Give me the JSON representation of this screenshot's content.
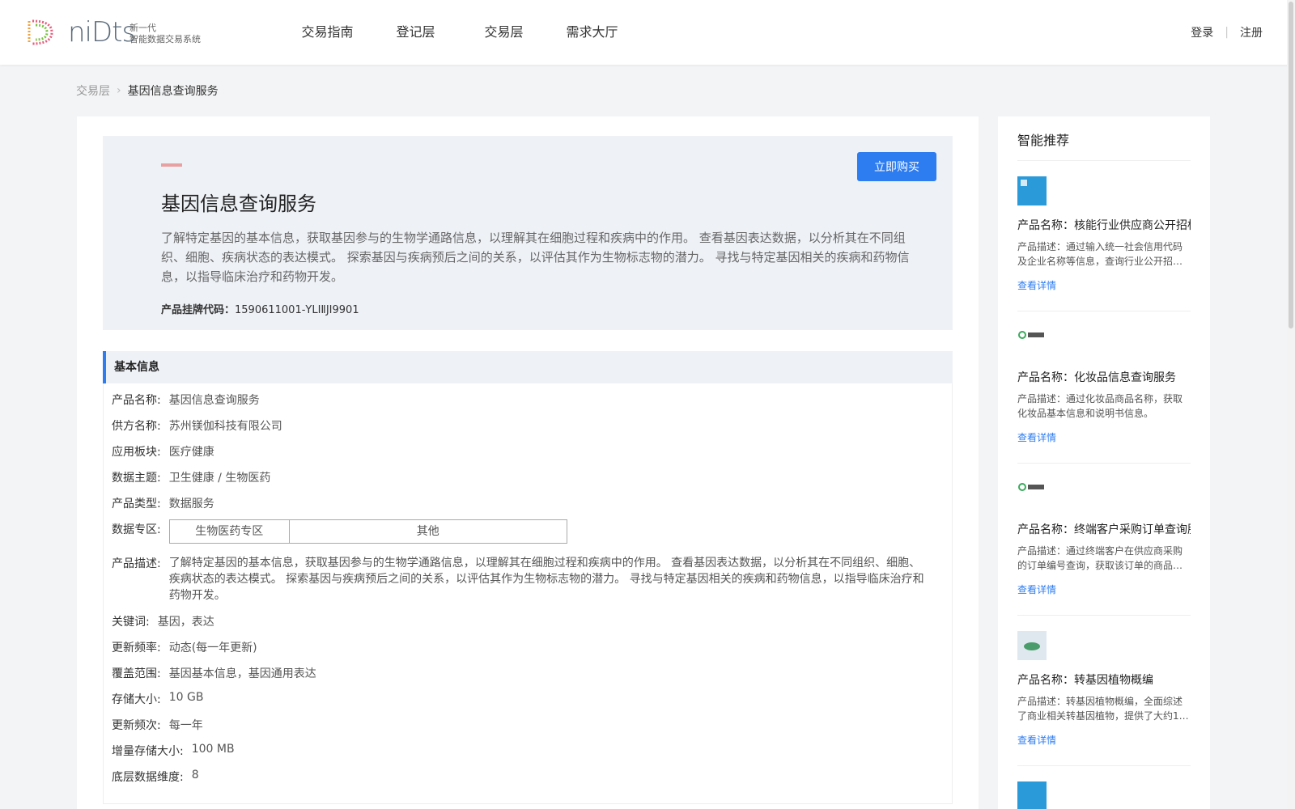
{
  "header": {
    "logo_word": "niDts",
    "logo_sub_line1": "新一代",
    "logo_sub_line2": "智能数据交易系统",
    "nav": [
      "交易指南",
      "登记层",
      "交易层",
      "需求大厅"
    ],
    "login": "登录",
    "register": "注册"
  },
  "breadcrumb": {
    "parent": "交易层",
    "current": "基因信息查询服务"
  },
  "hero": {
    "title": "基因信息查询服务",
    "description": "了解特定基因的基本信息，获取基因参与的生物学通路信息，以理解其在细胞过程和疾病中的作用。 查看基因表达数据，以分析其在不同组织、细胞、疾病状态的表达模式。 探索基因与疾病预后之间的关系，以评估其作为生物标志物的潜力。 寻找与特定基因相关的疾病和药物信息，以指导临床治疗和药物开发。",
    "code_label": "产品挂牌代码：",
    "code_value": "1590611001-YLIⅡJI9901",
    "buy_label": "立即购买"
  },
  "basic": {
    "section_title": "基本信息",
    "product_name": {
      "k": "产品名称:",
      "v": "基因信息查询服务"
    },
    "supplier": {
      "k": "供方名称:",
      "v": "苏州镁伽科技有限公司"
    },
    "sector": {
      "k": "应用板块:",
      "v": "医疗健康"
    },
    "topic": {
      "k": "数据主题:",
      "v": "卫生健康 / 生物医药"
    },
    "type": {
      "k": "产品类型:",
      "v": "数据服务"
    },
    "zone": {
      "k": "数据专区:",
      "v1": "生物医药专区",
      "v2": "其他"
    },
    "desc": {
      "k": "产品描述:",
      "v": "了解特定基因的基本信息，获取基因参与的生物学通路信息，以理解其在细胞过程和疾病中的作用。 查看基因表达数据，以分析其在不同组织、细胞、疾病状态的表达模式。 探索基因与疾病预后之间的关系，以评估其作为生物标志物的潜力。 寻找与特定基因相关的疾病和药物信息，以指导临床治疗和药物开发。"
    },
    "keywords": {
      "k": "关键词:",
      "v": "基因，表达"
    },
    "freq": {
      "k": "更新频率:",
      "v": "动态(每一年更新)"
    },
    "coverage": {
      "k": "覆盖范围:",
      "v": "基因基本信息，基因通用表达"
    },
    "storage": {
      "k": "存储大小:",
      "v": "10 GB"
    },
    "update_count": {
      "k": "更新频次:",
      "v": "每一年"
    },
    "incr": {
      "k": "增量存储大小:",
      "v": "100 MB"
    },
    "dims": {
      "k": "底层数据维度:",
      "v": "8"
    }
  },
  "side": {
    "title": "智能推荐",
    "link_label": "查看详情",
    "items": [
      {
        "name": "产品名称：核能行业供应商公开招标",
        "desc": "产品描述：通过输入统一社会信用代码及企业名称等信息，查询行业公开招…",
        "thumb": "blue"
      },
      {
        "name": "产品名称：化妆品信息查询服务",
        "desc": "产品描述：通过化妆品商品名称，获取化妆品基本信息和说明书信息。",
        "thumb": "logo"
      },
      {
        "name": "产品名称：终端客户采购订单查询服务",
        "desc": "产品描述：通过终端客户在供应商采购的订单编号查询，获取该订单的商品…",
        "thumb": "logo"
      },
      {
        "name": "产品名称：转基因植物概编",
        "desc": "产品描述：转基因植物概编，全面综述了商业相关转基因植物，提供了大约1…",
        "thumb": "book"
      }
    ]
  },
  "colors": {
    "accent": "#2d7cf0",
    "page_bg": "#f3f4f6",
    "hero_bg": "#eef1f6"
  }
}
